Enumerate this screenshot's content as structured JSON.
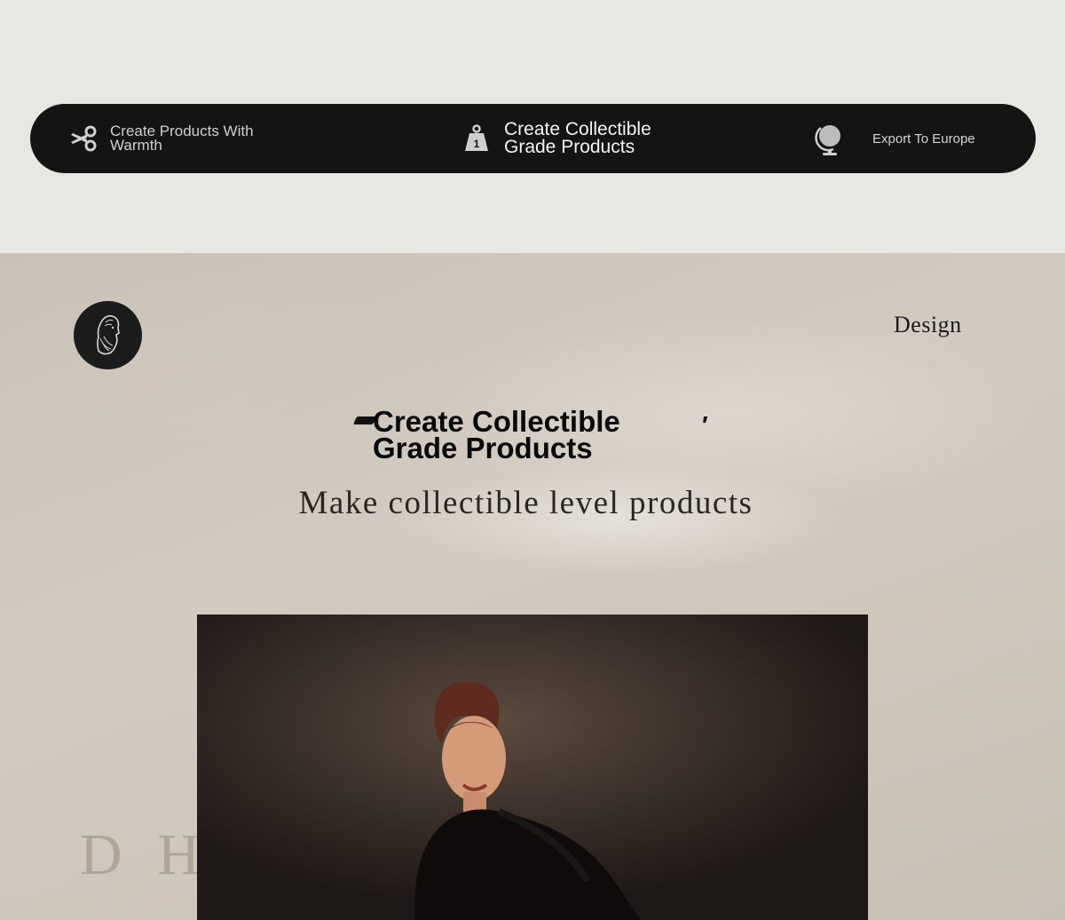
{
  "features": [
    {
      "icon": "scissors-icon",
      "label": "Create Products With Warmth"
    },
    {
      "icon": "weight-icon",
      "label": "Create Collectible Grade Products",
      "weight_number": "1"
    },
    {
      "icon": "globe-icon",
      "label": "Export To Europe"
    }
  ],
  "hero": {
    "nav_link": "Design",
    "title": "Create Collectible Grade Products",
    "subtitle": "Make collectible level products",
    "watermark": "DHARMS"
  },
  "colors": {
    "page_bg": "#e9e7e2",
    "bar_bg": "#141414",
    "hero_bg": "#cfc6ba",
    "title": "#080808"
  }
}
